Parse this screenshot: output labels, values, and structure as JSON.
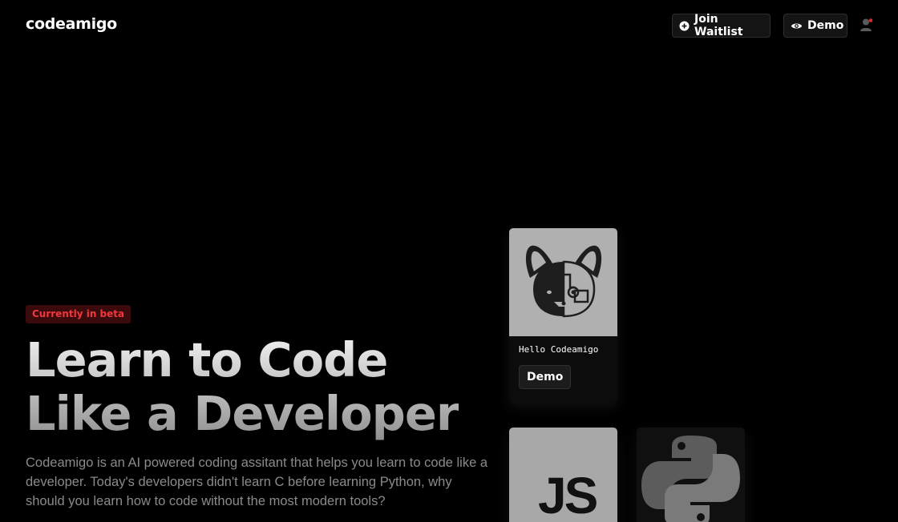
{
  "header": {
    "logo": "codeamigo",
    "join_waitlist_label": "Join Waitlist",
    "demo_label": "Demo"
  },
  "hero": {
    "badge": "Currently in beta",
    "title_line1": "Learn to Code",
    "title_line2": "Like a Developer",
    "description": "Codeamigo is an AI powered coding assitant that helps you learn to code like a developer. Today's developers didn't learn C before learning Python, why should you learn how to code without the most modern tools?"
  },
  "cards": {
    "main_caption": "Hello Codeamigo",
    "main_button": "Demo",
    "js_label": "JS"
  },
  "icons": {
    "waitlist": "plus-circle-icon",
    "demo": "eye-icon",
    "user": "user-icon",
    "mascot": "dog-robot-logo-icon",
    "python": "python-logo-icon"
  },
  "colors": {
    "background": "#000000",
    "badge_text": "#f0383c",
    "badge_bg": "#3a0a0c",
    "description": "#8a8a8a"
  }
}
